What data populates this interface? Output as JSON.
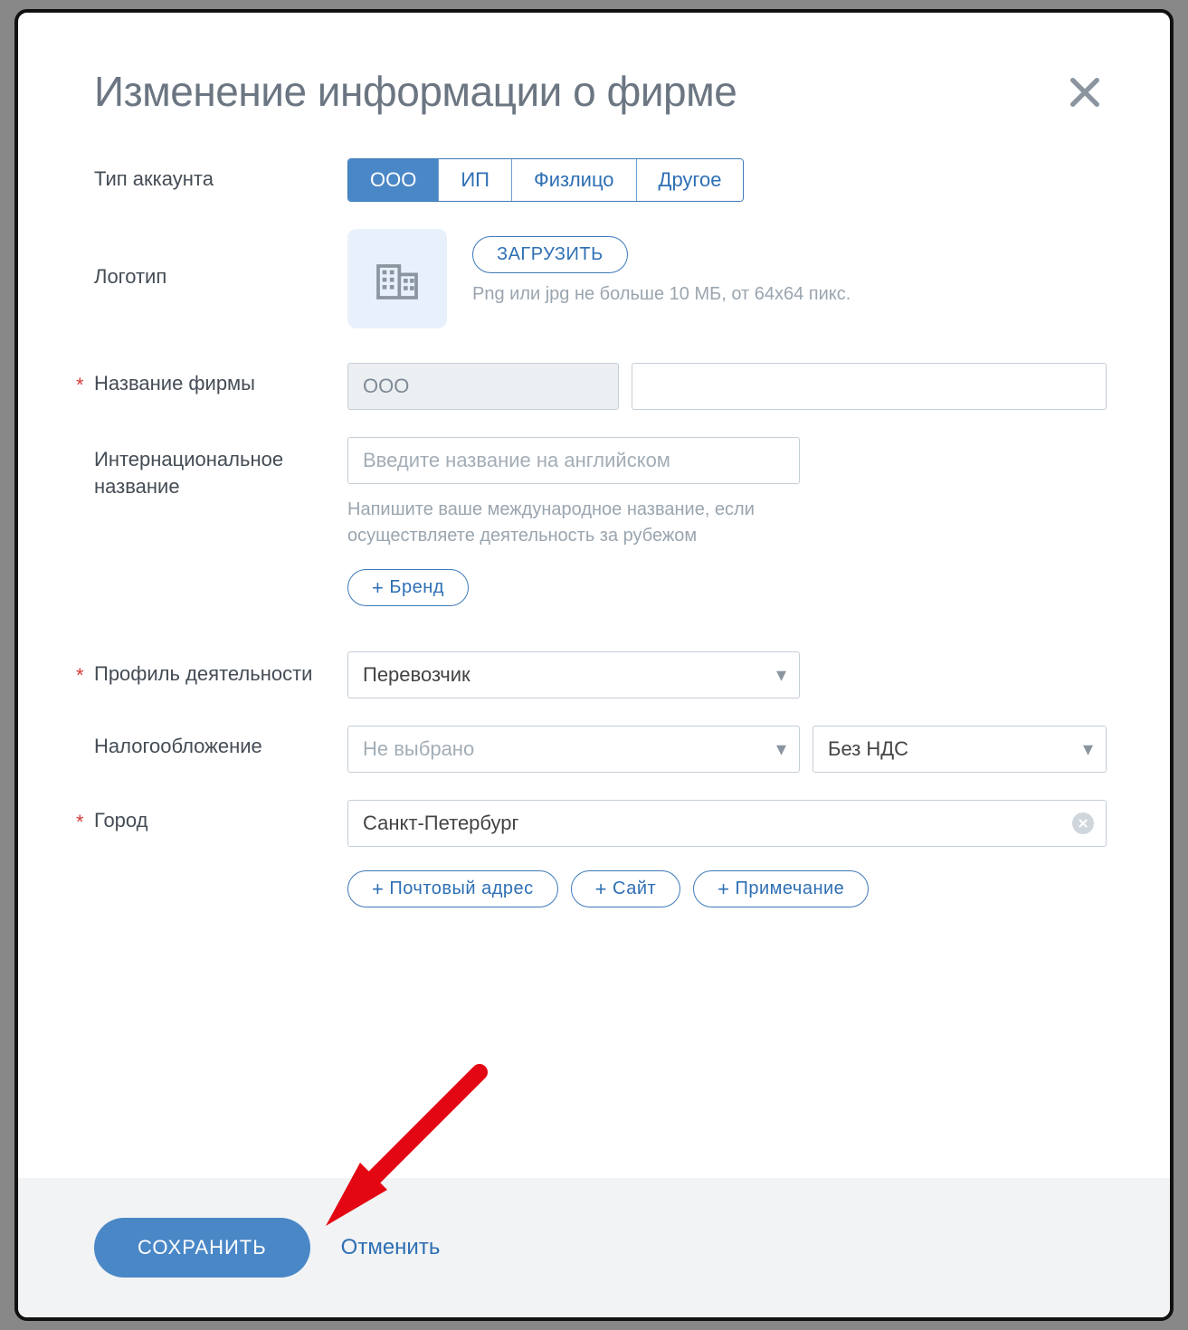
{
  "title": "Изменение информации о фирме",
  "labels": {
    "account_type": "Тип аккаунта",
    "logo": "Логотип",
    "company_name": "Название фирмы",
    "intl_name": "Интернациональное название",
    "profile": "Профиль деятельности",
    "taxation": "Налогообложение",
    "city": "Город"
  },
  "account_type": {
    "options": [
      "ООО",
      "ИП",
      "Физлицо",
      "Другое"
    ],
    "selected": "ООО"
  },
  "logo": {
    "upload_label": "ЗАГРУЗИТЬ",
    "hint": "Png или jpg не больше 10 МБ, от 64х64 пикс."
  },
  "company_name": {
    "prefix": "ООО",
    "value": ""
  },
  "intl_name": {
    "placeholder": "Введите название на английском",
    "subtext": "Напишите ваше международное название, если осуществляете деятельность за рубежом"
  },
  "brand_button": "Бренд",
  "profile_select": {
    "value": "Перевозчик"
  },
  "taxation": {
    "scheme_placeholder": "Не выбрано",
    "vat_value": "Без НДС"
  },
  "city": {
    "value": "Санкт-Петербург"
  },
  "extra_buttons": {
    "postal": "Почтовый адрес",
    "site": "Сайт",
    "note": "Примечание"
  },
  "footer": {
    "save": "СОХРАНИТЬ",
    "cancel": "Отменить"
  }
}
